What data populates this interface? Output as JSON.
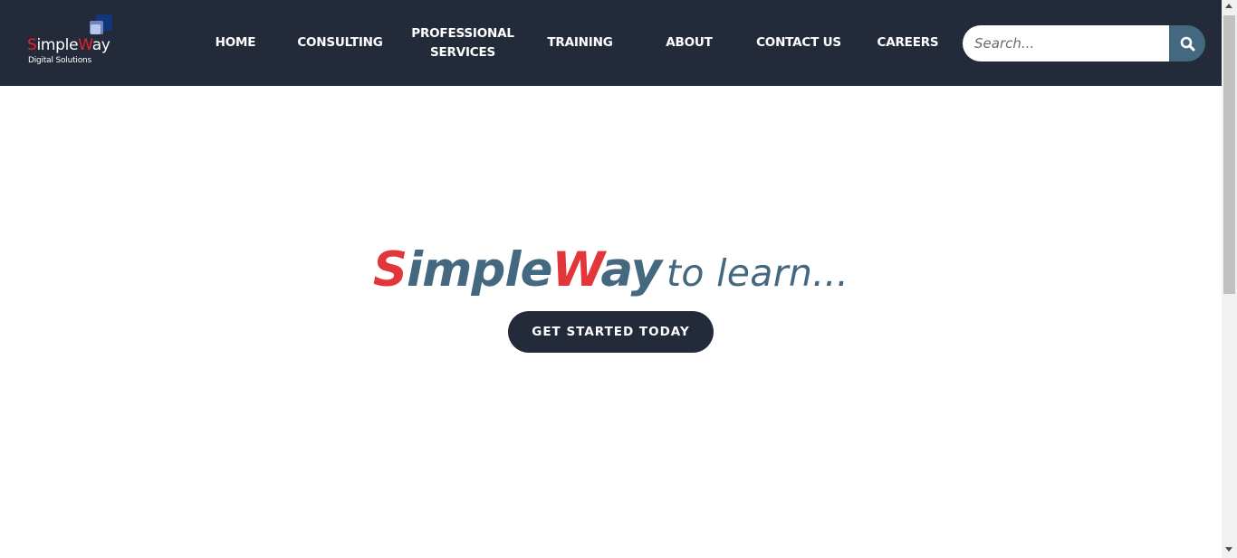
{
  "logo": {
    "name_first": "S",
    "name_mid": "imple",
    "name_w": "W",
    "name_end": "ay",
    "subtitle": "Digital Solutions"
  },
  "nav": {
    "items": [
      {
        "label": "HOME"
      },
      {
        "label": "CONSULTING"
      },
      {
        "label_line1": "PROFESSIONAL",
        "label_line2": "SERVICES"
      },
      {
        "label": "TRAINING"
      },
      {
        "label": "ABOUT"
      },
      {
        "label": "CONTACT US"
      },
      {
        "label": "CAREERS"
      }
    ]
  },
  "search": {
    "placeholder": "Search...",
    "icon": "search-icon"
  },
  "hero": {
    "brand_s": "S",
    "brand_imple": "imple",
    "brand_w": "W",
    "brand_ay": "ay",
    "tagline": "to learn...",
    "cta_label": "GET STARTED TODAY"
  },
  "colors": {
    "header_bg": "#232b3b",
    "accent_red": "#e3363b",
    "accent_slate": "#44687f"
  }
}
